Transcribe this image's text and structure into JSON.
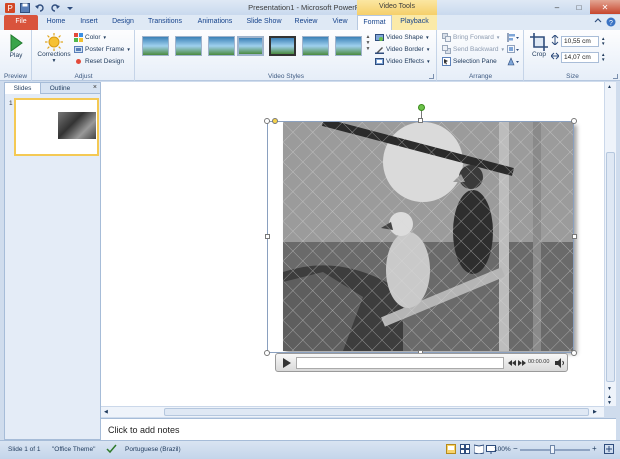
{
  "window": {
    "title": "Presentation1 - Microsoft PowerPoint",
    "contextual_header": "Video Tools"
  },
  "tabs": [
    "File",
    "Home",
    "Insert",
    "Design",
    "Transitions",
    "Animations",
    "Slide Show",
    "Review",
    "View",
    "Format",
    "Playback"
  ],
  "ribbon": {
    "preview": {
      "play_label": "Play",
      "group_label": "Preview"
    },
    "adjust": {
      "corrections_label": "Corrections",
      "color_label": "Color",
      "poster_frame_label": "Poster Frame",
      "reset_design_label": "Reset Design",
      "group_label": "Adjust"
    },
    "video_styles": {
      "group_label": "Video Styles",
      "video_shape_label": "Video Shape",
      "video_border_label": "Video Border",
      "video_effects_label": "Video Effects"
    },
    "arrange": {
      "bring_forward_label": "Bring Forward",
      "send_backward_label": "Send Backward",
      "selection_pane_label": "Selection Pane",
      "group_label": "Arrange"
    },
    "size": {
      "crop_label": "Crop",
      "height_value": "10,55 cm",
      "width_value": "14,07 cm",
      "group_label": "Size"
    }
  },
  "slides_pane": {
    "tab_slides": "Slides",
    "tab_outline": "Outline",
    "close_glyph": "×",
    "slide_number": "1"
  },
  "video": {
    "time": "00:00.00"
  },
  "notes": {
    "placeholder": "Click to add notes"
  },
  "statusbar": {
    "slide_info": "Slide 1 of 1",
    "theme": "\"Office Theme\"",
    "language": "Portuguese (Brazil)",
    "zoom": "100%"
  }
}
